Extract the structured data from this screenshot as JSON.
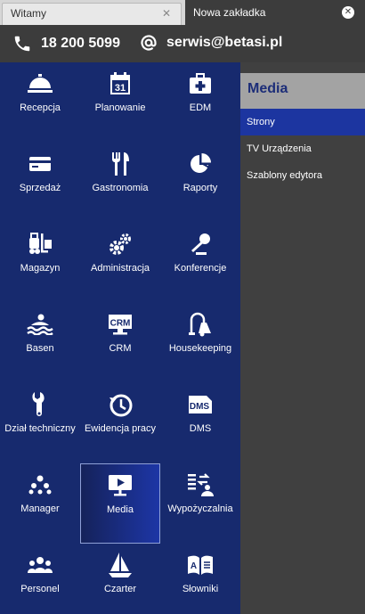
{
  "tabs": [
    {
      "label": "Witamy",
      "active": false
    },
    {
      "label": "Nowa zakładka",
      "active": true
    }
  ],
  "contact": {
    "phone": "18 200 5099",
    "email": "serwis@betasi.pl"
  },
  "modules": [
    {
      "label": "Recepcja",
      "icon": "reception-bell-icon"
    },
    {
      "label": "Planowanie",
      "icon": "calendar-31-icon"
    },
    {
      "label": "EDM",
      "icon": "medical-kit-icon"
    },
    {
      "label": "Sprzedaż",
      "icon": "credit-card-icon"
    },
    {
      "label": "Gastronomia",
      "icon": "fork-knife-icon"
    },
    {
      "label": "Raporty",
      "icon": "pie-chart-icon"
    },
    {
      "label": "Magazyn",
      "icon": "forklift-icon"
    },
    {
      "label": "Administracja",
      "icon": "gears-icon"
    },
    {
      "label": "Konferencje",
      "icon": "microphone-icon"
    },
    {
      "label": "Basen",
      "icon": "swimmer-icon"
    },
    {
      "label": "CRM",
      "icon": "crm-icon"
    },
    {
      "label": "Housekeeping",
      "icon": "vacuum-cleaner-icon"
    },
    {
      "label": "Dział techniczny",
      "icon": "wrench-icon"
    },
    {
      "label": "Ewidencja pracy",
      "icon": "clock-history-icon"
    },
    {
      "label": "DMS",
      "icon": "dms-document-icon"
    },
    {
      "label": "Manager",
      "icon": "org-chart-icon"
    },
    {
      "label": "Media",
      "icon": "presentation-screen-icon",
      "selected": true
    },
    {
      "label": "Wypożyczalnia",
      "icon": "rental-exchange-icon"
    },
    {
      "label": "Personel",
      "icon": "people-group-icon"
    },
    {
      "label": "Czarter",
      "icon": "sailboat-icon"
    },
    {
      "label": "Słowniki",
      "icon": "dictionary-book-icon"
    }
  ],
  "side_panel": {
    "title": "Media",
    "items": [
      {
        "label": "Strony",
        "active": true
      },
      {
        "label": "TV Urządzenia",
        "active": false
      },
      {
        "label": "Szablony edytora",
        "active": false
      }
    ]
  },
  "colors": {
    "grid_bg": "#172a6e",
    "active_item": "#1c35a0",
    "panel_title": "#1c2d78",
    "dark_bar": "#3c3c3c"
  }
}
